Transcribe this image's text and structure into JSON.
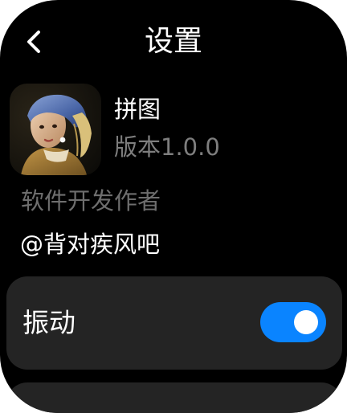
{
  "header": {
    "title": "设置",
    "back_icon": "chevron-left-icon"
  },
  "app": {
    "icon": "girl-with-pearl-earring-painting",
    "name": "拼图",
    "version": "版本1.0.0"
  },
  "developer": {
    "label": "软件开发作者",
    "name": "@背对疾风吧"
  },
  "settings": {
    "vibration_label": "振动",
    "vibration_on": true
  },
  "colors": {
    "background": "#000000",
    "card": "#242424",
    "accent": "#0a84ff",
    "secondary_text": "#7e7e7e"
  }
}
